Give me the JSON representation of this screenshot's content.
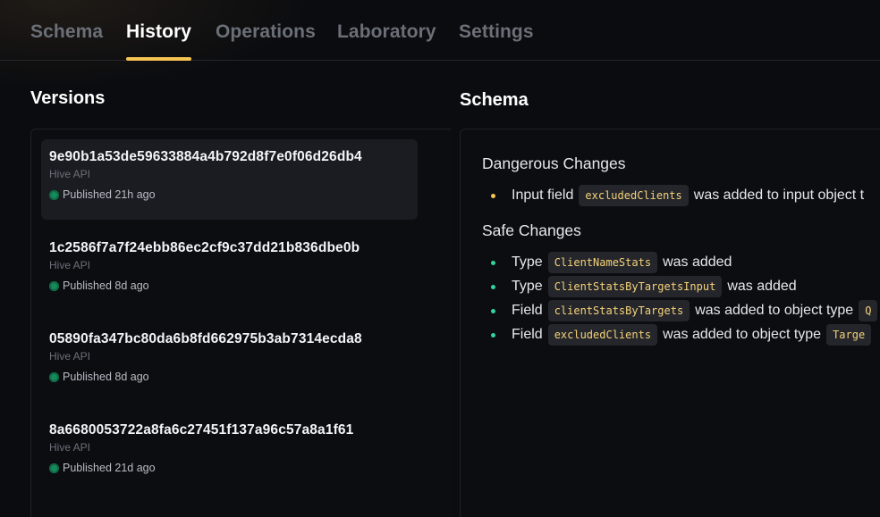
{
  "tabs": [
    {
      "label": "Schema",
      "active": false
    },
    {
      "label": "History",
      "active": true
    },
    {
      "label": "Operations",
      "active": false
    },
    {
      "label": "Laboratory",
      "active": false
    },
    {
      "label": "Settings",
      "active": false
    }
  ],
  "versions": {
    "title": "Versions",
    "items": [
      {
        "hash": "9e90b1a53de59633884a4b792d8f7e0f06d26db4",
        "target": "Hive API",
        "status": "Published 21h ago",
        "selected": true
      },
      {
        "hash": "1c2586f7a7f24ebb86ec2cf9c37dd21b836dbe0b",
        "target": "Hive API",
        "status": "Published 8d ago",
        "selected": false
      },
      {
        "hash": "05890fa347bc80da6b8fd662975b3ab7314ecda8",
        "target": "Hive API",
        "status": "Published 8d ago",
        "selected": false
      },
      {
        "hash": "8a6680053722a8fa6c27451f137a96c57a8a1f61",
        "target": "Hive API",
        "status": "Published 21d ago",
        "selected": false
      }
    ]
  },
  "schema": {
    "title": "Schema",
    "dangerous": {
      "heading": "Dangerous Changes",
      "items": [
        {
          "prefix": "Input field",
          "code": "excludedClients",
          "suffix": "was added to input object t"
        }
      ]
    },
    "safe": {
      "heading": "Safe Changes",
      "items": [
        {
          "prefix": "Type",
          "code": "ClientNameStats",
          "suffix": "was added",
          "code2": ""
        },
        {
          "prefix": "Type",
          "code": "ClientStatsByTargetsInput",
          "suffix": "was added",
          "code2": ""
        },
        {
          "prefix": "Field",
          "code": "clientStatsByTargets",
          "suffix": "was added to object type",
          "code2": "Q"
        },
        {
          "prefix": "Field",
          "code": "excludedClients",
          "suffix": "was added to object type",
          "code2": "Targe"
        }
      ]
    }
  },
  "colors": {
    "accent": "#f6c453",
    "success": "#178a5b",
    "safe_bullet": "#34d399",
    "code_text": "#f6d27a"
  }
}
